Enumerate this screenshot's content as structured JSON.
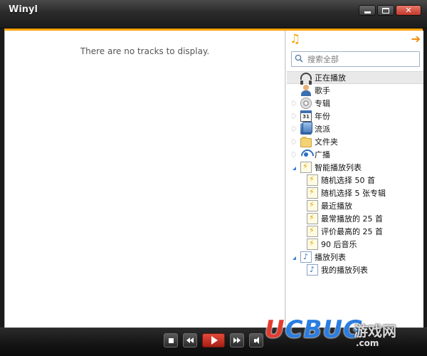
{
  "window": {
    "title": "Winyl",
    "close_glyph": "✕"
  },
  "tracklist": {
    "empty_message": "There are no tracks to display."
  },
  "library": {
    "top_icons": [
      "music-note-icon",
      "arrow-right-icon"
    ],
    "search": {
      "placeholder": "搜索全部",
      "value": ""
    },
    "nodes": [
      {
        "label": "正在播放",
        "icon": "headphones-icon",
        "expander": "none",
        "selected": true
      },
      {
        "label": "歌手",
        "icon": "artist-icon",
        "expander": "none"
      },
      {
        "label": "专辑",
        "icon": "disc-icon",
        "expander": "closed"
      },
      {
        "label": "年份",
        "icon": "calendar-icon",
        "expander": "closed",
        "icon_text": "31"
      },
      {
        "label": "流派",
        "icon": "genre-icon",
        "expander": "closed"
      },
      {
        "label": "文件夹",
        "icon": "folder-icon",
        "expander": "closed"
      },
      {
        "label": "广播",
        "icon": "radio-icon",
        "expander": "closed"
      },
      {
        "label": "智能播放列表",
        "icon": "smart-playlist-icon",
        "expander": "open"
      },
      {
        "label": "随机选择 50 首",
        "icon": "smart-playlist-icon",
        "child": true
      },
      {
        "label": "随机选择 5 张专辑",
        "icon": "smart-playlist-icon",
        "child": true
      },
      {
        "label": "最近播放",
        "icon": "smart-playlist-icon",
        "child": true
      },
      {
        "label": "最常播放的 25 首",
        "icon": "smart-playlist-icon",
        "child": true
      },
      {
        "label": "评价最高的 25 首",
        "icon": "smart-playlist-icon",
        "child": true
      },
      {
        "label": "90 后音乐",
        "icon": "smart-playlist-icon",
        "child": true
      },
      {
        "label": "播放列表",
        "icon": "playlist-icon",
        "expander": "open"
      },
      {
        "label": "我的播放列表",
        "icon": "playlist-icon",
        "child": true
      }
    ]
  },
  "controls": [
    "stop",
    "previous",
    "play",
    "next",
    "volume"
  ],
  "watermark": {
    "brand_u": "U",
    "brand_rest": "CBUG",
    "cn": "游戏网",
    "domain": ".com"
  },
  "colors": {
    "accent_orange": "#f4a000",
    "play_red": "#c8281c",
    "tree_expander_blue": "#3a7fd8"
  }
}
